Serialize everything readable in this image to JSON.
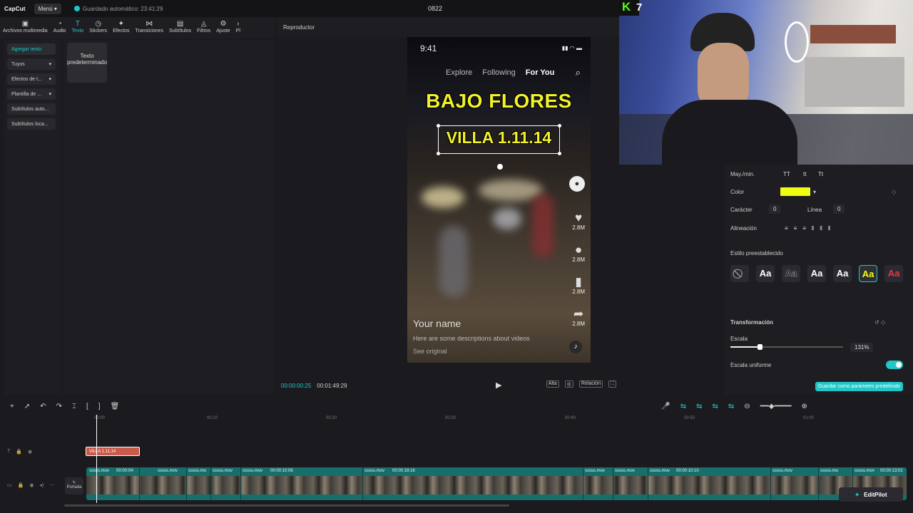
{
  "topbar": {
    "logo": "CapCut",
    "menu": "Menú",
    "autosave": "Guardado automático: 23:41:29",
    "project": "0822"
  },
  "tools": [
    {
      "label": "Archivos multimedia",
      "icon": "media-icon"
    },
    {
      "label": "Audio",
      "icon": "audio-icon"
    },
    {
      "label": "Texto",
      "icon": "text-icon",
      "active": true
    },
    {
      "label": "Stickers",
      "icon": "sticker-icon"
    },
    {
      "label": "Efectos",
      "icon": "effects-icon"
    },
    {
      "label": "Transiciones",
      "icon": "transition-icon"
    },
    {
      "label": "Subtítulos",
      "icon": "subtitle-icon"
    },
    {
      "label": "Filtros",
      "icon": "filter-icon"
    },
    {
      "label": "Ajuste",
      "icon": "adjust-icon"
    },
    {
      "label": "Pl",
      "icon": "plugin-icon"
    }
  ],
  "leftnav": [
    "Agregar texto",
    "Tuyos",
    "Efectos de t...",
    "Plantilla de ...",
    "Subtítulos auto...",
    "Subtítulos loca..."
  ],
  "content": {
    "card": "Texto predeterminado"
  },
  "player": {
    "header": "Reproductor",
    "current_time": "00:00:00:25",
    "total_time": "00:01:49:29",
    "ratio_label": "Relación",
    "alta": "Alta"
  },
  "phone": {
    "time": "9:41",
    "tabs": [
      "Explore",
      "Following",
      "For You"
    ],
    "title1": "BAJO FLORES",
    "title2": "VILLA 1.11.14",
    "likes": "2.8M",
    "comments": "2.8M",
    "saves": "2.8M",
    "shares": "2.8M",
    "your_name": "Your name",
    "description": "Here are some descriptions about videos",
    "see_original": "See original"
  },
  "webcam": {
    "badge": "7"
  },
  "props": {
    "case_label": "May./min.",
    "case_opts": [
      "TT",
      "tt",
      "Tt"
    ],
    "color_label": "Color",
    "color_value": "#f0ff12",
    "char_label": "Carácter",
    "char_value": "0",
    "line_label": "Línea",
    "line_value": "0",
    "align_label": "Alineación",
    "preset_label": "Estilo preestablecido",
    "presets": [
      "Aa",
      "Aa",
      "Aa",
      "Aa",
      "Aa",
      "Aa"
    ],
    "transform_label": "Transformación",
    "scale_label": "Escala",
    "scale_value": "131%",
    "uniform_label": "Escala uniforme",
    "save_preset": "Guardar como parámetro predefinido"
  },
  "timeline": {
    "ruler": [
      "00:00",
      "00:10",
      "00:20",
      "00:30",
      "00:40",
      "00:50",
      "01:00"
    ],
    "text_clip": "VILLA 1.11.14",
    "cover_label": "Portada",
    "clips": [
      {
        "name": "sssss.mov",
        "time": "00:00:04:"
      },
      {
        "name": "sssss.mov",
        "time": ""
      },
      {
        "name": "sssss.mo",
        "time": ""
      },
      {
        "name": "sssss.mov",
        "time": ""
      },
      {
        "name": "sssss.mov",
        "time": "00:00:10:06"
      },
      {
        "name": "sssss.mov",
        "time": "00:00:18:16"
      },
      {
        "name": "sssss.mov",
        "time": ""
      },
      {
        "name": "sssss.mov",
        "time": ""
      },
      {
        "name": "sssss.mov",
        "time": "00:00:10:10"
      },
      {
        "name": "sssss.mov",
        "time": ""
      },
      {
        "name": "sssss.mo",
        "time": ""
      },
      {
        "name": "sssss.mov",
        "time": "00:00:13:02"
      }
    ],
    "editpilot": "EditPilot"
  }
}
